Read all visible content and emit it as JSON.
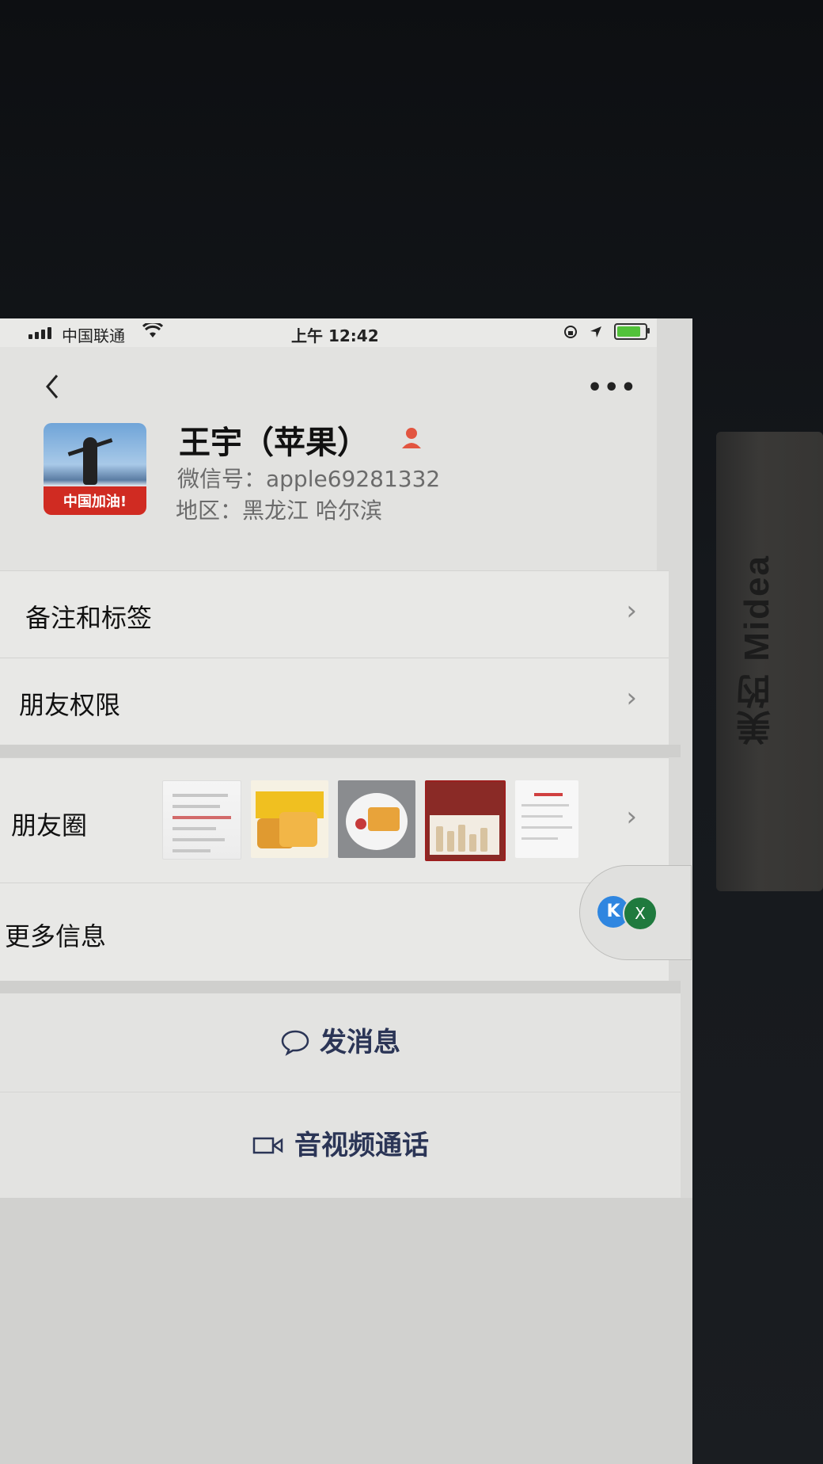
{
  "status_bar": {
    "carrier": "中国联通",
    "time": "上午 12:42",
    "battery_level": 0.85,
    "battery_color": "#52c23a"
  },
  "header": {
    "back_icon": "chevron-left-icon",
    "more_icon": "more-dots-icon",
    "more_label": "•••",
    "avatar_banner_text": "中国加油!",
    "name": "王宇（苹果）",
    "wechat_id": "微信号：apple69281332",
    "region": "地区：黑龙江 哈尔滨",
    "user_icon_color": "#e25540"
  },
  "rows": {
    "remarks_tags": "备注和标签",
    "friend_permissions": "朋友权限",
    "moments": "朋友圈",
    "more_info": "更多信息",
    "chevron": "›"
  },
  "floating_widget": {
    "k_label": "K",
    "x_label": "X"
  },
  "actions": {
    "send_message": "发消息",
    "voice_video_call": "音视频通话",
    "accent_color": "#2b3556"
  },
  "background": {
    "appliance_text": "美的 Midea"
  }
}
